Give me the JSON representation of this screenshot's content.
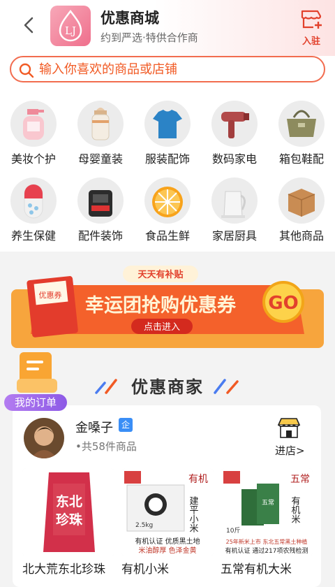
{
  "header": {
    "title": "优惠商城",
    "subtitle": "约到严选·特供合作商",
    "logo_text": "LJ",
    "settle_label": "入驻"
  },
  "search": {
    "placeholder": "输入你喜欢的商品或店铺"
  },
  "categories": [
    {
      "label": "美妆个护",
      "icon": "cosmetics-bottle"
    },
    {
      "label": "母婴童装",
      "icon": "baby-bottle"
    },
    {
      "label": "服装配饰",
      "icon": "tshirt"
    },
    {
      "label": "数码家电",
      "icon": "hair-dryer"
    },
    {
      "label": "箱包鞋配",
      "icon": "handbag"
    },
    {
      "label": "养生保健",
      "icon": "capsule"
    },
    {
      "label": "配件装饰",
      "icon": "car-accessory"
    },
    {
      "label": "食品生鲜",
      "icon": "orange"
    },
    {
      "label": "家居厨具",
      "icon": "kettle"
    },
    {
      "label": "其他商品",
      "icon": "package-box"
    }
  ],
  "banner": {
    "badge": "天天有补贴",
    "headline": "幸运团抢购优惠券",
    "cta": "点击进入",
    "coupon_label": "优惠券",
    "coin_text": "GO"
  },
  "section": {
    "title": "优惠商家"
  },
  "float_order": {
    "label": "我的订单"
  },
  "merchant": {
    "name": "金嗓子",
    "verified_badge": "企",
    "count": "•共58件商品",
    "enter_label": "进店>",
    "products": [
      {
        "name": "北大荒东北珍珠",
        "pack_text": "东北珍珠"
      },
      {
        "name": "有机小米",
        "pack_tag": "有机",
        "side_text": "建平小米",
        "caption1": "有机认证 优质黑土地",
        "caption2": "米油醇厚 色泽金黄",
        "weight": "2.5kg"
      },
      {
        "name": "五常有机大米",
        "pack_tag": "五常",
        "side_text": "有机米",
        "caption1": "25年新米上市 东北五常黑土种植",
        "caption2": "有机认证 通过217项农残检测",
        "weight": "10斤"
      }
    ]
  },
  "colors": {
    "accent": "#f15a24",
    "brand_pink": "#ef6f8c",
    "order_purple": "#8d5ae6"
  }
}
